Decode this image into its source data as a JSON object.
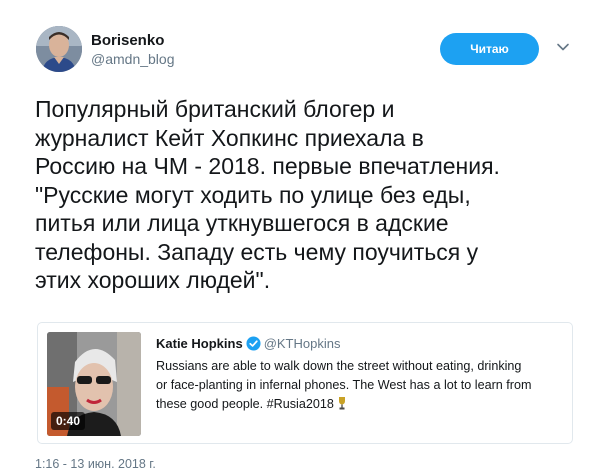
{
  "author": {
    "display_name": "Borisenko",
    "handle": "@amdn_blog"
  },
  "follow_button": {
    "label": "Читаю"
  },
  "tweet": {
    "lines": [
      "Популярный британский блогер и",
      "журналист Кейт Хопкинс приехала в",
      "Россию на ЧМ - 2018. первые впечатления.",
      "\"Русские могут ходить по улице без еды,",
      "питья или лица уткнувшегося в адские",
      "телефоны. Западу есть чему поучиться у",
      "этих хороших людей\"."
    ]
  },
  "quoted_tweet": {
    "name": "Katie Hopkins",
    "handle": "@KTHopkins",
    "video_duration": "0:40",
    "lines": [
      "Russians are able to walk down the street without eating, drinking",
      "or face-planting in infernal phones. The West has a lot to learn from",
      "these good people. #Rusia2018"
    ]
  },
  "timestamp": "1:16 - 13 июн. 2018 г.",
  "colors": {
    "accent": "#1da1f2",
    "text": "#14171a",
    "secondary_text": "#657786",
    "border": "#e1e8ed"
  }
}
